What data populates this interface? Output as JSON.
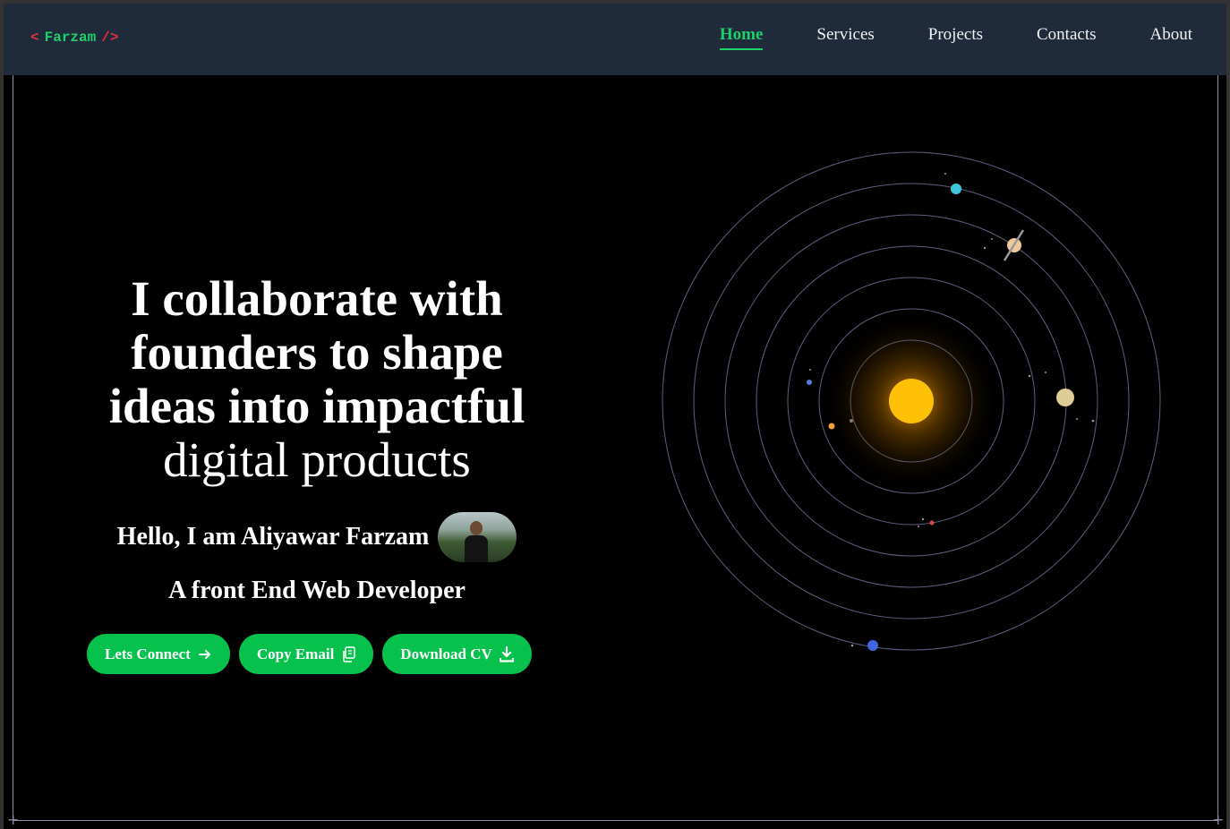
{
  "navbar": {
    "logo": {
      "open": "<",
      "name": "Farzam",
      "close": "/>"
    },
    "links": [
      {
        "label": "Home",
        "active": true
      },
      {
        "label": "Services",
        "active": false
      },
      {
        "label": "Projects",
        "active": false
      },
      {
        "label": "Contacts",
        "active": false
      },
      {
        "label": "About",
        "active": false
      }
    ]
  },
  "hero": {
    "headline_bold": [
      "I collaborate with",
      "founders to shape",
      "ideas into impactful"
    ],
    "headline_light": "digital products",
    "greeting": "Hello, I am Aliyawar Farzam",
    "role": "A front End Web Developer",
    "buttons": {
      "connect": "Lets Connect",
      "copy_email": "Copy Email",
      "download_cv": "Download CV"
    }
  },
  "colors": {
    "accent_green": "#06c24d",
    "nav_active": "#1fd16a",
    "logo_bracket": "#e0333d",
    "navbar_bg": "#1f2a3a",
    "sun": "#ffc107",
    "orbit": "#5b6080"
  },
  "icons": {
    "connect": "arrow-right-icon",
    "copy_email": "copy-icon",
    "download_cv": "download-icon"
  }
}
